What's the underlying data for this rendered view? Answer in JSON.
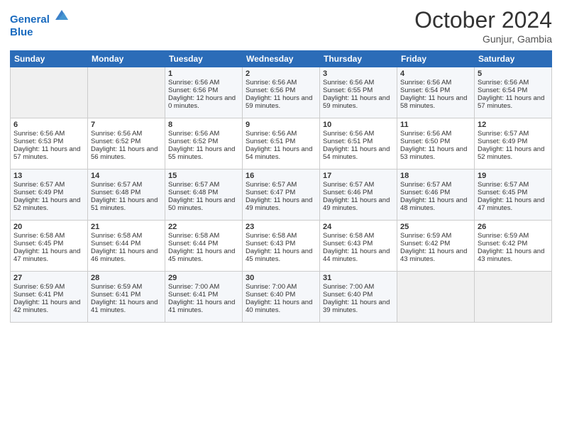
{
  "header": {
    "logo_line1": "General",
    "logo_line2": "Blue",
    "month": "October 2024",
    "location": "Gunjur, Gambia"
  },
  "days_of_week": [
    "Sunday",
    "Monday",
    "Tuesday",
    "Wednesday",
    "Thursday",
    "Friday",
    "Saturday"
  ],
  "weeks": [
    [
      {
        "day": "",
        "sunrise": "",
        "sunset": "",
        "daylight": ""
      },
      {
        "day": "",
        "sunrise": "",
        "sunset": "",
        "daylight": ""
      },
      {
        "day": "1",
        "sunrise": "Sunrise: 6:56 AM",
        "sunset": "Sunset: 6:56 PM",
        "daylight": "Daylight: 12 hours and 0 minutes."
      },
      {
        "day": "2",
        "sunrise": "Sunrise: 6:56 AM",
        "sunset": "Sunset: 6:56 PM",
        "daylight": "Daylight: 11 hours and 59 minutes."
      },
      {
        "day": "3",
        "sunrise": "Sunrise: 6:56 AM",
        "sunset": "Sunset: 6:55 PM",
        "daylight": "Daylight: 11 hours and 59 minutes."
      },
      {
        "day": "4",
        "sunrise": "Sunrise: 6:56 AM",
        "sunset": "Sunset: 6:54 PM",
        "daylight": "Daylight: 11 hours and 58 minutes."
      },
      {
        "day": "5",
        "sunrise": "Sunrise: 6:56 AM",
        "sunset": "Sunset: 6:54 PM",
        "daylight": "Daylight: 11 hours and 57 minutes."
      }
    ],
    [
      {
        "day": "6",
        "sunrise": "Sunrise: 6:56 AM",
        "sunset": "Sunset: 6:53 PM",
        "daylight": "Daylight: 11 hours and 57 minutes."
      },
      {
        "day": "7",
        "sunrise": "Sunrise: 6:56 AM",
        "sunset": "Sunset: 6:52 PM",
        "daylight": "Daylight: 11 hours and 56 minutes."
      },
      {
        "day": "8",
        "sunrise": "Sunrise: 6:56 AM",
        "sunset": "Sunset: 6:52 PM",
        "daylight": "Daylight: 11 hours and 55 minutes."
      },
      {
        "day": "9",
        "sunrise": "Sunrise: 6:56 AM",
        "sunset": "Sunset: 6:51 PM",
        "daylight": "Daylight: 11 hours and 54 minutes."
      },
      {
        "day": "10",
        "sunrise": "Sunrise: 6:56 AM",
        "sunset": "Sunset: 6:51 PM",
        "daylight": "Daylight: 11 hours and 54 minutes."
      },
      {
        "day": "11",
        "sunrise": "Sunrise: 6:56 AM",
        "sunset": "Sunset: 6:50 PM",
        "daylight": "Daylight: 11 hours and 53 minutes."
      },
      {
        "day": "12",
        "sunrise": "Sunrise: 6:57 AM",
        "sunset": "Sunset: 6:49 PM",
        "daylight": "Daylight: 11 hours and 52 minutes."
      }
    ],
    [
      {
        "day": "13",
        "sunrise": "Sunrise: 6:57 AM",
        "sunset": "Sunset: 6:49 PM",
        "daylight": "Daylight: 11 hours and 52 minutes."
      },
      {
        "day": "14",
        "sunrise": "Sunrise: 6:57 AM",
        "sunset": "Sunset: 6:48 PM",
        "daylight": "Daylight: 11 hours and 51 minutes."
      },
      {
        "day": "15",
        "sunrise": "Sunrise: 6:57 AM",
        "sunset": "Sunset: 6:48 PM",
        "daylight": "Daylight: 11 hours and 50 minutes."
      },
      {
        "day": "16",
        "sunrise": "Sunrise: 6:57 AM",
        "sunset": "Sunset: 6:47 PM",
        "daylight": "Daylight: 11 hours and 49 minutes."
      },
      {
        "day": "17",
        "sunrise": "Sunrise: 6:57 AM",
        "sunset": "Sunset: 6:46 PM",
        "daylight": "Daylight: 11 hours and 49 minutes."
      },
      {
        "day": "18",
        "sunrise": "Sunrise: 6:57 AM",
        "sunset": "Sunset: 6:46 PM",
        "daylight": "Daylight: 11 hours and 48 minutes."
      },
      {
        "day": "19",
        "sunrise": "Sunrise: 6:57 AM",
        "sunset": "Sunset: 6:45 PM",
        "daylight": "Daylight: 11 hours and 47 minutes."
      }
    ],
    [
      {
        "day": "20",
        "sunrise": "Sunrise: 6:58 AM",
        "sunset": "Sunset: 6:45 PM",
        "daylight": "Daylight: 11 hours and 47 minutes."
      },
      {
        "day": "21",
        "sunrise": "Sunrise: 6:58 AM",
        "sunset": "Sunset: 6:44 PM",
        "daylight": "Daylight: 11 hours and 46 minutes."
      },
      {
        "day": "22",
        "sunrise": "Sunrise: 6:58 AM",
        "sunset": "Sunset: 6:44 PM",
        "daylight": "Daylight: 11 hours and 45 minutes."
      },
      {
        "day": "23",
        "sunrise": "Sunrise: 6:58 AM",
        "sunset": "Sunset: 6:43 PM",
        "daylight": "Daylight: 11 hours and 45 minutes."
      },
      {
        "day": "24",
        "sunrise": "Sunrise: 6:58 AM",
        "sunset": "Sunset: 6:43 PM",
        "daylight": "Daylight: 11 hours and 44 minutes."
      },
      {
        "day": "25",
        "sunrise": "Sunrise: 6:59 AM",
        "sunset": "Sunset: 6:42 PM",
        "daylight": "Daylight: 11 hours and 43 minutes."
      },
      {
        "day": "26",
        "sunrise": "Sunrise: 6:59 AM",
        "sunset": "Sunset: 6:42 PM",
        "daylight": "Daylight: 11 hours and 43 minutes."
      }
    ],
    [
      {
        "day": "27",
        "sunrise": "Sunrise: 6:59 AM",
        "sunset": "Sunset: 6:41 PM",
        "daylight": "Daylight: 11 hours and 42 minutes."
      },
      {
        "day": "28",
        "sunrise": "Sunrise: 6:59 AM",
        "sunset": "Sunset: 6:41 PM",
        "daylight": "Daylight: 11 hours and 41 minutes."
      },
      {
        "day": "29",
        "sunrise": "Sunrise: 7:00 AM",
        "sunset": "Sunset: 6:41 PM",
        "daylight": "Daylight: 11 hours and 41 minutes."
      },
      {
        "day": "30",
        "sunrise": "Sunrise: 7:00 AM",
        "sunset": "Sunset: 6:40 PM",
        "daylight": "Daylight: 11 hours and 40 minutes."
      },
      {
        "day": "31",
        "sunrise": "Sunrise: 7:00 AM",
        "sunset": "Sunset: 6:40 PM",
        "daylight": "Daylight: 11 hours and 39 minutes."
      },
      {
        "day": "",
        "sunrise": "",
        "sunset": "",
        "daylight": ""
      },
      {
        "day": "",
        "sunrise": "",
        "sunset": "",
        "daylight": ""
      }
    ]
  ]
}
